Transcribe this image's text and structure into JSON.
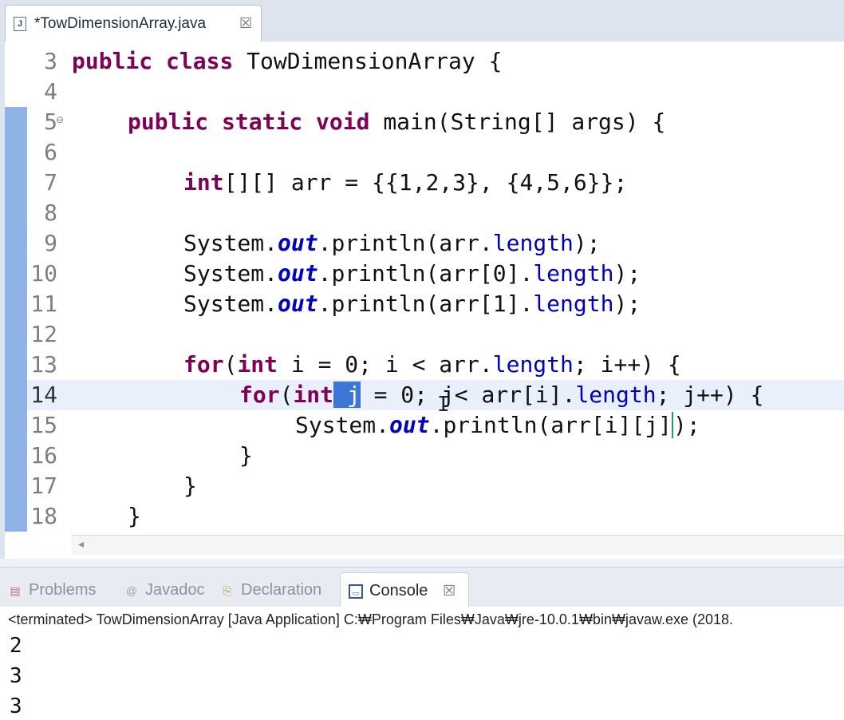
{
  "editor_tab": {
    "title": "*TowDimensionArray.java",
    "file_icon": "java-file-icon",
    "close_icon": "close-icon"
  },
  "editor": {
    "lines": [
      {
        "number": "3",
        "current": false,
        "marked": false
      },
      {
        "number": "4",
        "current": false,
        "marked": false
      },
      {
        "number": "5",
        "current": false,
        "marked": true,
        "fold": "⊖"
      },
      {
        "number": "6",
        "current": false,
        "marked": true
      },
      {
        "number": "7",
        "current": false,
        "marked": true
      },
      {
        "number": "8",
        "current": false,
        "marked": true
      },
      {
        "number": "9",
        "current": false,
        "marked": true
      },
      {
        "number": "10",
        "current": false,
        "marked": true
      },
      {
        "number": "11",
        "current": false,
        "marked": true
      },
      {
        "number": "12",
        "current": false,
        "marked": true
      },
      {
        "number": "13",
        "current": false,
        "marked": true
      },
      {
        "number": "14",
        "current": true,
        "marked": true
      },
      {
        "number": "15",
        "current": false,
        "marked": true
      },
      {
        "number": "16",
        "current": false,
        "marked": true
      },
      {
        "number": "17",
        "current": false,
        "marked": true
      },
      {
        "number": "18",
        "current": false,
        "marked": true
      }
    ],
    "code": {
      "l3": {
        "kw1": "public",
        "kw2": "class",
        "rest": " TowDimensionArray {"
      },
      "l5": {
        "kw1": "public",
        "kw2": "static",
        "kw3": "void",
        "rest": " main(String[] args) {"
      },
      "l7": {
        "kw": "int",
        "rest": "[][] arr = {{1,2,3}, {4,5,6}};"
      },
      "l9": {
        "a": "System.",
        "out": "out",
        "b": ".println(arr.",
        "field": "length",
        "c": ");"
      },
      "l10": {
        "a": "System.",
        "out": "out",
        "b": ".println(arr[0].",
        "field": "length",
        "c": ");"
      },
      "l11": {
        "a": "System.",
        "out": "out",
        "b": ".println(arr[1].",
        "field": "length",
        "c": ");"
      },
      "l13": {
        "kw1": "for",
        "p1": "(",
        "kw2": "int",
        "p2": " i = 0; i < arr.",
        "field": "length",
        "p3": "; i++) {"
      },
      "l14": {
        "kw1": "for",
        "p1": "(",
        "kw2": "int",
        "sel": " j",
        "p2": " = 0; j< arr[i].",
        "field": "length",
        "p3": "; j++) {"
      },
      "l15": {
        "a": "System.",
        "out": "out",
        "b": ".println(arr[i][j]",
        "c": ");"
      },
      "l16": "}",
      "l17": "}",
      "l18": "}"
    }
  },
  "views": {
    "tabs": [
      {
        "label": "Problems",
        "icon": "problems-icon",
        "active": false
      },
      {
        "label": "Javadoc",
        "icon": "at-icon",
        "active": false
      },
      {
        "label": "Declaration",
        "icon": "declaration-icon",
        "active": false
      },
      {
        "label": "Console",
        "icon": "console-icon",
        "active": true
      }
    ],
    "close_icon": "close-icon"
  },
  "console": {
    "status": "<terminated> TowDimensionArray [Java Application] C:₩Program Files₩Java₩jre-10.0.1₩bin₩javaw.exe (2018.",
    "output": [
      "2",
      "3",
      "3"
    ]
  },
  "colors": {
    "keyword": "#7f0055",
    "field": "#0000c0",
    "selection": "#3c76d6",
    "current_line": "#e9f0fb"
  }
}
